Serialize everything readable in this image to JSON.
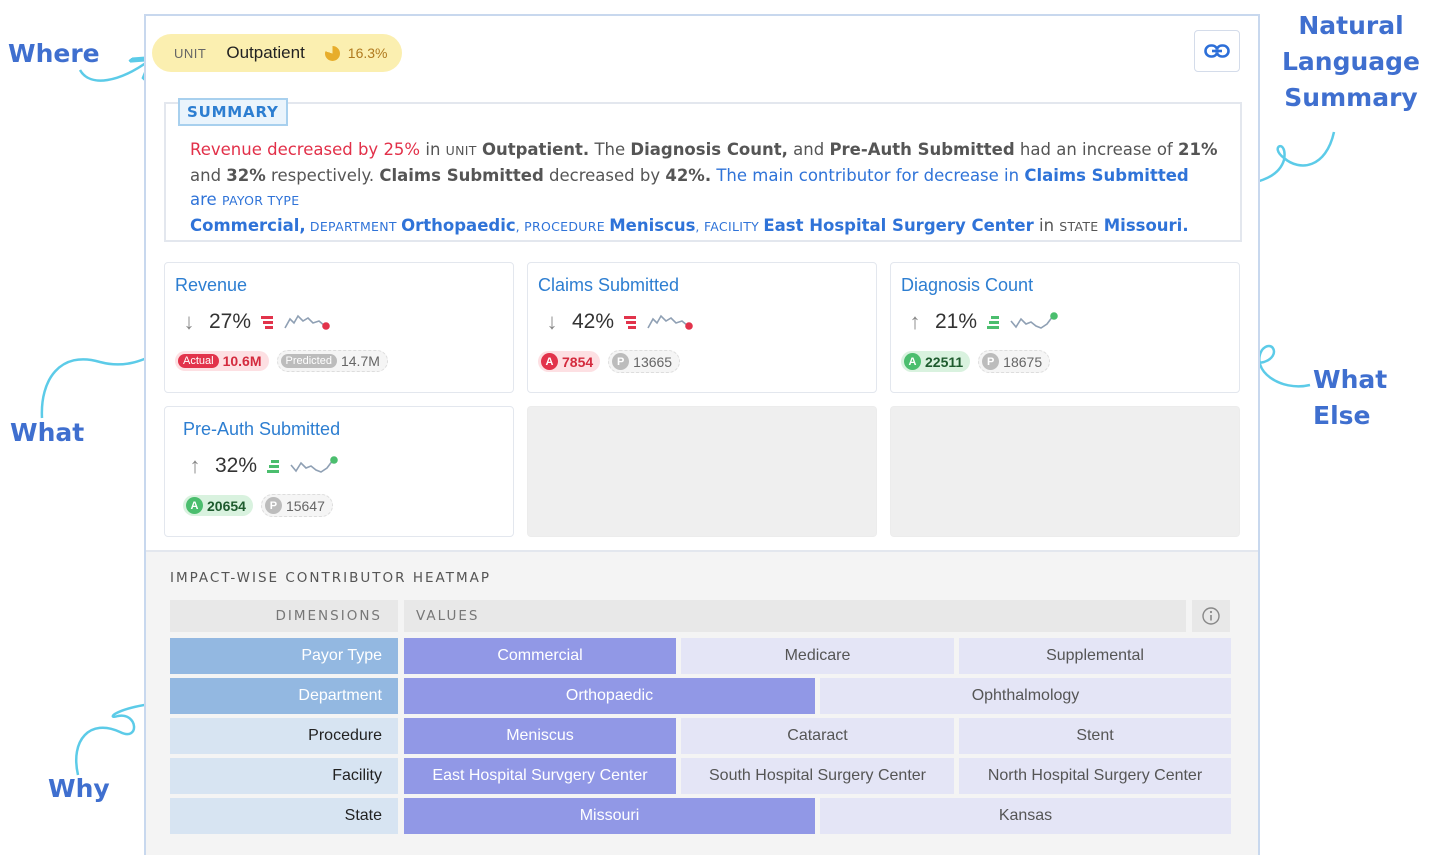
{
  "annotations": {
    "where": "Where",
    "what": "What",
    "why": "Why",
    "what_else": "What Else",
    "nls_line1": "Natural",
    "nls_line2": "Language",
    "nls_line3": "Summary"
  },
  "unit": {
    "label": "UNIT",
    "value": "Outpatient",
    "pct": "16.3%"
  },
  "link_button": {
    "icon": "link-icon"
  },
  "summary": {
    "tag": "SUMMARY",
    "t01": "Revenue",
    "t02": "decreased by 25%",
    "t03": " in ",
    "t04": "unit",
    "t05": " ",
    "t06": "Outpatient.",
    "t07": " The ",
    "t08": "Diagnosis Count,",
    "t09": " and ",
    "t10": "Pre-Auth Submitted",
    "t11": " had an increase of ",
    "t12": "21%",
    "t13": " and ",
    "t14": "32%",
    "t15": " respectively. ",
    "t16": "Claims Submitted",
    "t17": " decreased by ",
    "t18": "42%.",
    "t19": " The main contributor for decrease in ",
    "t20": "Claims Submitted",
    "t21": " are ",
    "t22": "payor type",
    "t23": "Commercial,",
    "t24": " department ",
    "t25": "Orthopaedic",
    "t26": ", procedure ",
    "t27": "Meniscus",
    "t28": ", facility ",
    "t29": "East Hospital Surgery Center",
    "t30": " in ",
    "t31": "state",
    "t32": " ",
    "t33": "Missouri."
  },
  "cards": [
    {
      "title": "Revenue",
      "direction": "down",
      "pct": "27%",
      "actual_label": "Actual",
      "actual": "10.6M",
      "predicted_label": "Predicted",
      "predicted": "14.7M"
    },
    {
      "title": "Claims Submitted",
      "direction": "down",
      "pct": "42%",
      "actual_label": "A",
      "actual": "7854",
      "predicted_label": "P",
      "predicted": "13665"
    },
    {
      "title": "Diagnosis Count",
      "direction": "up",
      "pct": "21%",
      "actual_label": "A",
      "actual": "22511",
      "predicted_label": "P",
      "predicted": "18675"
    },
    {
      "title": "Pre-Auth Submitted",
      "direction": "up",
      "pct": "32%",
      "actual_label": "A",
      "actual": "20654",
      "predicted_label": "P",
      "predicted": "15647"
    }
  ],
  "arrows": {
    "down": "↓",
    "up": "↑"
  },
  "colors": {
    "down": "#e2334b",
    "up": "#4bbe6e",
    "accent": "#2d7ed1",
    "heat_high": "#9198e6",
    "heat_low": "#e4e5f6"
  },
  "heatmap": {
    "title": "IMPACT-WISE CONTRIBUTOR HEATMAP",
    "col_dimensions": "DIMENSIONS",
    "col_values": "VALUES",
    "info_icon": "info-icon",
    "rows": [
      {
        "dimension": "Payor Type",
        "active": true,
        "values": [
          {
            "label": "Commercial",
            "high": true
          },
          {
            "label": "Medicare",
            "high": false
          },
          {
            "label": "Supplemental",
            "high": false
          }
        ]
      },
      {
        "dimension": "Department",
        "active": true,
        "values": [
          {
            "label": "Orthopaedic",
            "high": true
          },
          {
            "label": "Ophthalmology",
            "high": false
          }
        ]
      },
      {
        "dimension": "Procedure",
        "active": false,
        "values": [
          {
            "label": "Meniscus",
            "high": true
          },
          {
            "label": "Cataract",
            "high": false
          },
          {
            "label": "Stent",
            "high": false
          }
        ]
      },
      {
        "dimension": "Facility",
        "active": false,
        "values": [
          {
            "label": "East Hospital Survgery Center",
            "high": true
          },
          {
            "label": "South Hospital Surgery Center",
            "high": false
          },
          {
            "label": "North Hospital Surgery Center",
            "high": false
          }
        ]
      },
      {
        "dimension": "State",
        "active": false,
        "values": [
          {
            "label": "Missouri",
            "high": true
          },
          {
            "label": "Kansas",
            "high": false
          }
        ]
      }
    ]
  }
}
